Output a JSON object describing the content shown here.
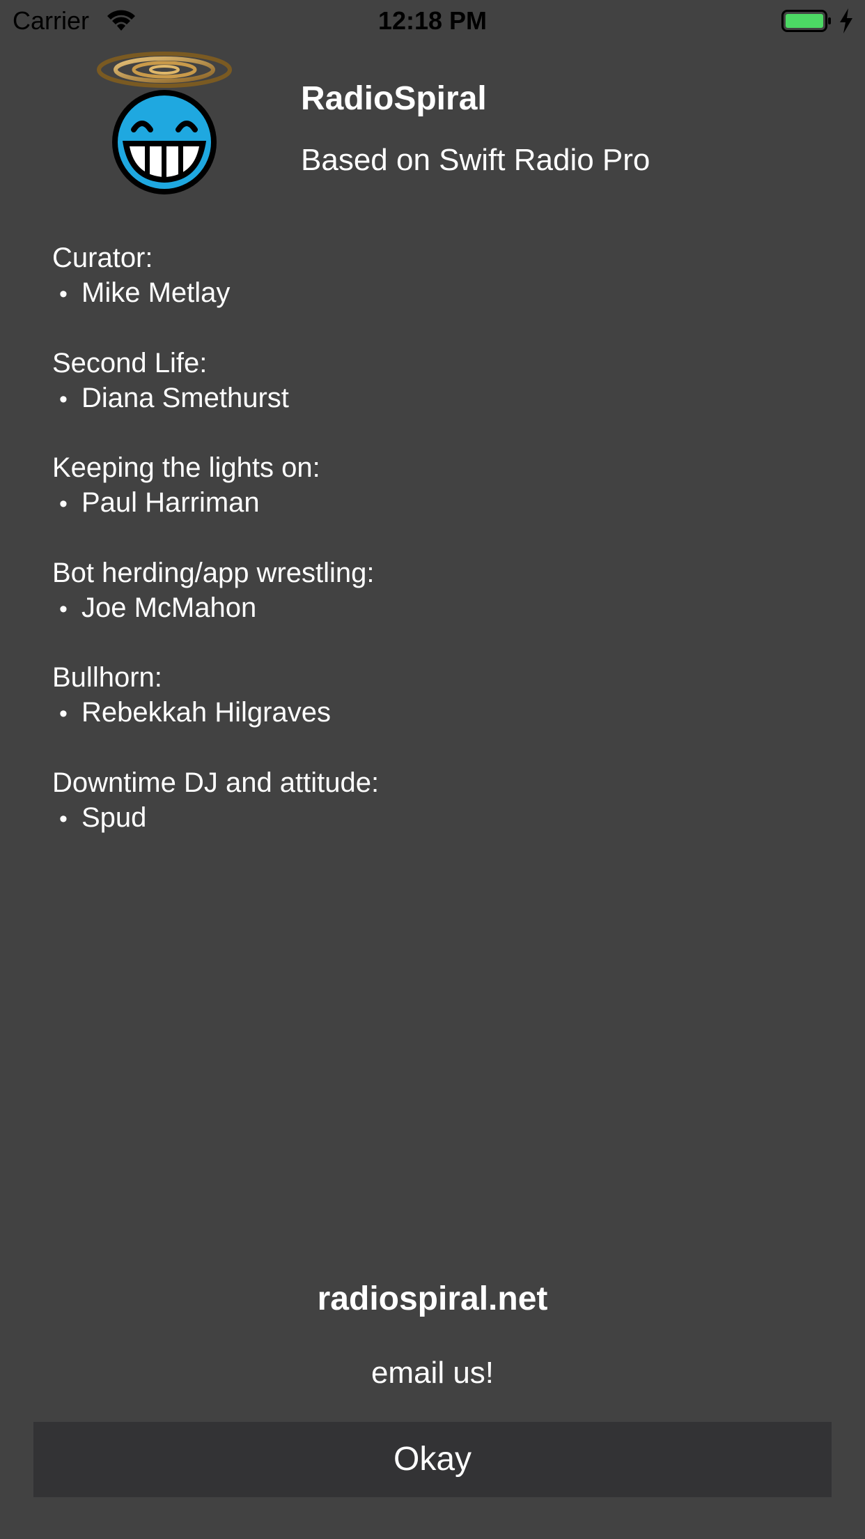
{
  "status_bar": {
    "carrier": "Carrier",
    "time": "12:18 PM",
    "battery_color": "#4cd964"
  },
  "header": {
    "logo_icon": "radiospiral-smiley-spiral-logo",
    "title": "RadioSpiral",
    "subtitle": "Based on Swift Radio Pro"
  },
  "credits": [
    {
      "role": "Curator:",
      "name": "Mike Metlay"
    },
    {
      "role": "Second Life:",
      "name": "Diana Smethurst"
    },
    {
      "role": "Keeping the lights on:",
      "name": "Paul Harriman"
    },
    {
      "role": "Bot herding/app wrestling:",
      "name": "Joe McMahon"
    },
    {
      "role": "Bullhorn:",
      "name": "Rebekkah Hilgraves"
    },
    {
      "role": "Downtime DJ and attitude:",
      "name": "Spud"
    }
  ],
  "footer": {
    "website": "radiospiral.net",
    "email": "email us!",
    "okay_label": "Okay"
  },
  "colors": {
    "background": "#424242",
    "button_background": "#333335",
    "text": "#ffffff"
  }
}
